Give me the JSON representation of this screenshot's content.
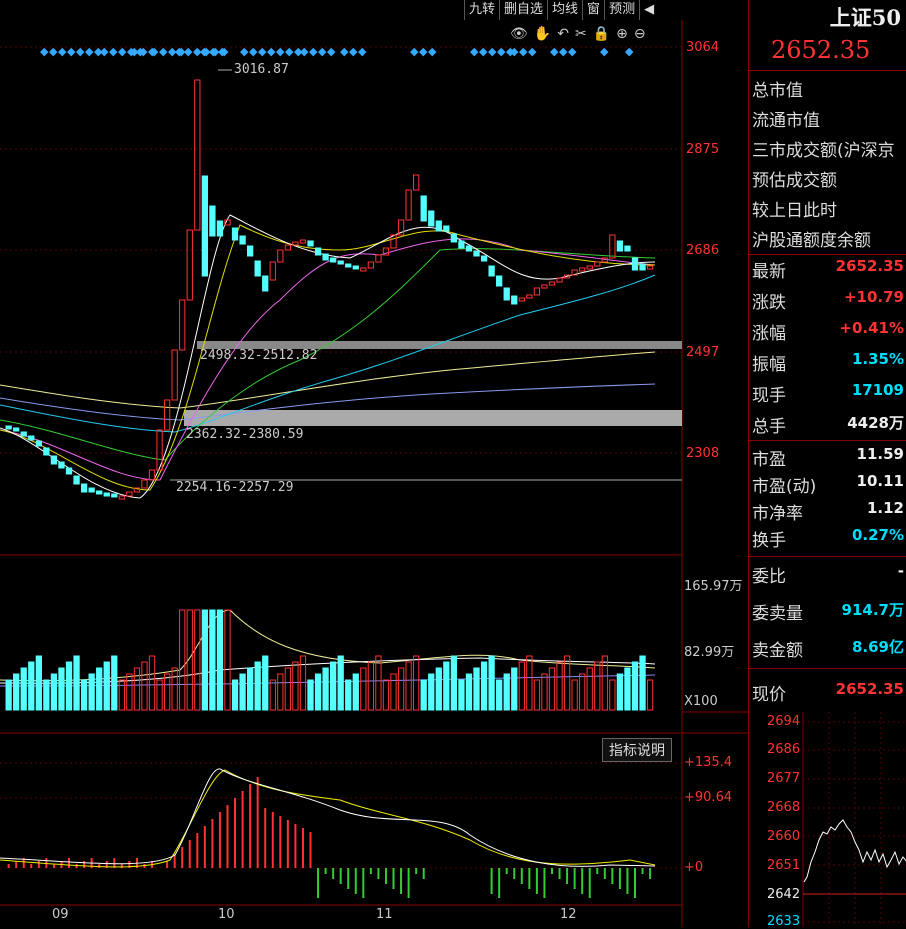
{
  "toolbar": {
    "items": [
      "九转",
      "删自选",
      "均线",
      "窗",
      "预测"
    ]
  },
  "main_chart": {
    "price_axis": [
      "3064",
      "2875",
      "2686",
      "2497",
      "2308"
    ],
    "annotations": {
      "high": "3016.87",
      "gap_upper": "2498.32-2512.82",
      "gap_lower": "2362.32-2380.59",
      "low_gap": "2254.16-2257.29"
    }
  },
  "volume_chart": {
    "axis": [
      "165.97万",
      "82.99万"
    ],
    "unit": "X100"
  },
  "macd_chart": {
    "button": "指标说明",
    "axis": [
      "+135.4",
      "+90.64",
      "+0"
    ]
  },
  "date_axis": [
    "09",
    "10",
    "11",
    "12"
  ],
  "panel": {
    "title": "上证50",
    "price": "2652.35",
    "labels": [
      "总市值",
      "流通市值",
      "三市成交额(沪深京",
      "预估成交额",
      "较上日此时",
      "沪股通额度余额"
    ],
    "quotes": [
      {
        "label": "最新",
        "value": "2652.35",
        "color": "#ff3333"
      },
      {
        "label": "涨跌",
        "value": "+10.79",
        "color": "#ff3333"
      },
      {
        "label": "涨幅",
        "value": "+0.41%",
        "color": "#ff3333"
      },
      {
        "label": "振幅",
        "value": "1.35%",
        "color": "#00ddff"
      },
      {
        "label": "现手",
        "value": "17109",
        "color": "#00ddff"
      },
      {
        "label": "总手",
        "value": "4428万",
        "color": "#eeeeee"
      }
    ],
    "valuation": [
      {
        "label": "市盈",
        "value": "11.59",
        "color": "#eeeeee"
      },
      {
        "label": "市盈(动)",
        "value": "10.11",
        "color": "#eeeeee"
      },
      {
        "label": "市净率",
        "value": "1.12",
        "color": "#eeeeee"
      },
      {
        "label": "换手",
        "value": "0.27%",
        "color": "#00ddff"
      }
    ],
    "order": [
      {
        "label": "委比",
        "value": "-",
        "color": "#eeeeee"
      },
      {
        "label": "委卖量",
        "value": "914.7万",
        "color": "#00ddff"
      },
      {
        "label": "卖金额",
        "value": "8.69亿",
        "color": "#00ddff"
      }
    ],
    "current": {
      "label": "现价",
      "value": "2652.35"
    },
    "mini_axis": [
      "2694",
      "2686",
      "2677",
      "2668",
      "2660",
      "2651",
      "2642",
      "2633"
    ]
  }
}
